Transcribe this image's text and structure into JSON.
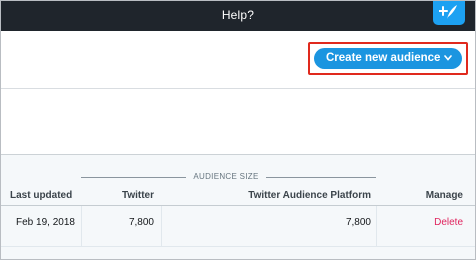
{
  "topbar": {
    "help_label": "Help?",
    "compose_icon": "compose-tweet-icon"
  },
  "actions": {
    "create_audience_label": "Create new audience",
    "create_audience_icon": "chevron-down-icon"
  },
  "table": {
    "group_header": "AUDIENCE SIZE",
    "columns": [
      "Last updated",
      "Twitter",
      "Twitter Audience Platform",
      "Manage"
    ],
    "rows": [
      {
        "last_updated": "Feb 19, 2018",
        "twitter": "7,800",
        "tap": "7,800",
        "manage": "Delete"
      }
    ]
  },
  "colors": {
    "topbar": "#1f252c",
    "primary_button": "#1b95e0",
    "highlight_border": "#e0291d",
    "delete_link": "#e0245e"
  }
}
